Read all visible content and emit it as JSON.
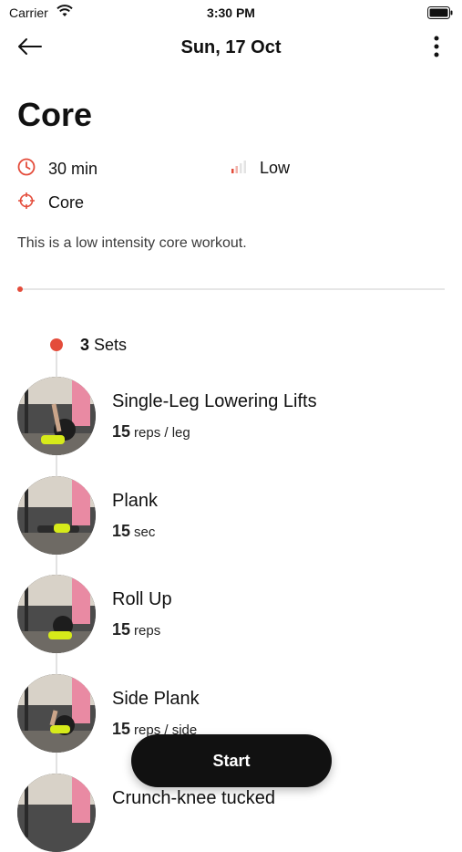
{
  "status_bar": {
    "carrier": "Carrier",
    "time": "3:30 PM"
  },
  "nav": {
    "title": "Sun, 17 Oct"
  },
  "workout": {
    "title": "Core",
    "duration": "30 min",
    "intensity": "Low",
    "focus": "Core",
    "description": "This is a low intensity core workout."
  },
  "sets": {
    "count": "3",
    "label": "Sets"
  },
  "exercises": [
    {
      "name": "Single-Leg Lowering Lifts",
      "amount": "15",
      "unit": "reps / leg"
    },
    {
      "name": "Plank",
      "amount": "15",
      "unit": "sec"
    },
    {
      "name": "Roll Up",
      "amount": "15",
      "unit": "reps"
    },
    {
      "name": "Side Plank",
      "amount": "15",
      "unit": "reps / side"
    },
    {
      "name": "Crunch-knee tucked",
      "amount": "",
      "unit": ""
    }
  ],
  "start_button": {
    "label": "Start"
  },
  "colors": {
    "accent": "#e44c3b",
    "button": "#111111"
  },
  "icons": [
    "wifi-icon",
    "battery-icon",
    "back-arrow-icon",
    "more-vertical-icon",
    "clock-icon",
    "intensity-bars-icon",
    "target-icon"
  ]
}
